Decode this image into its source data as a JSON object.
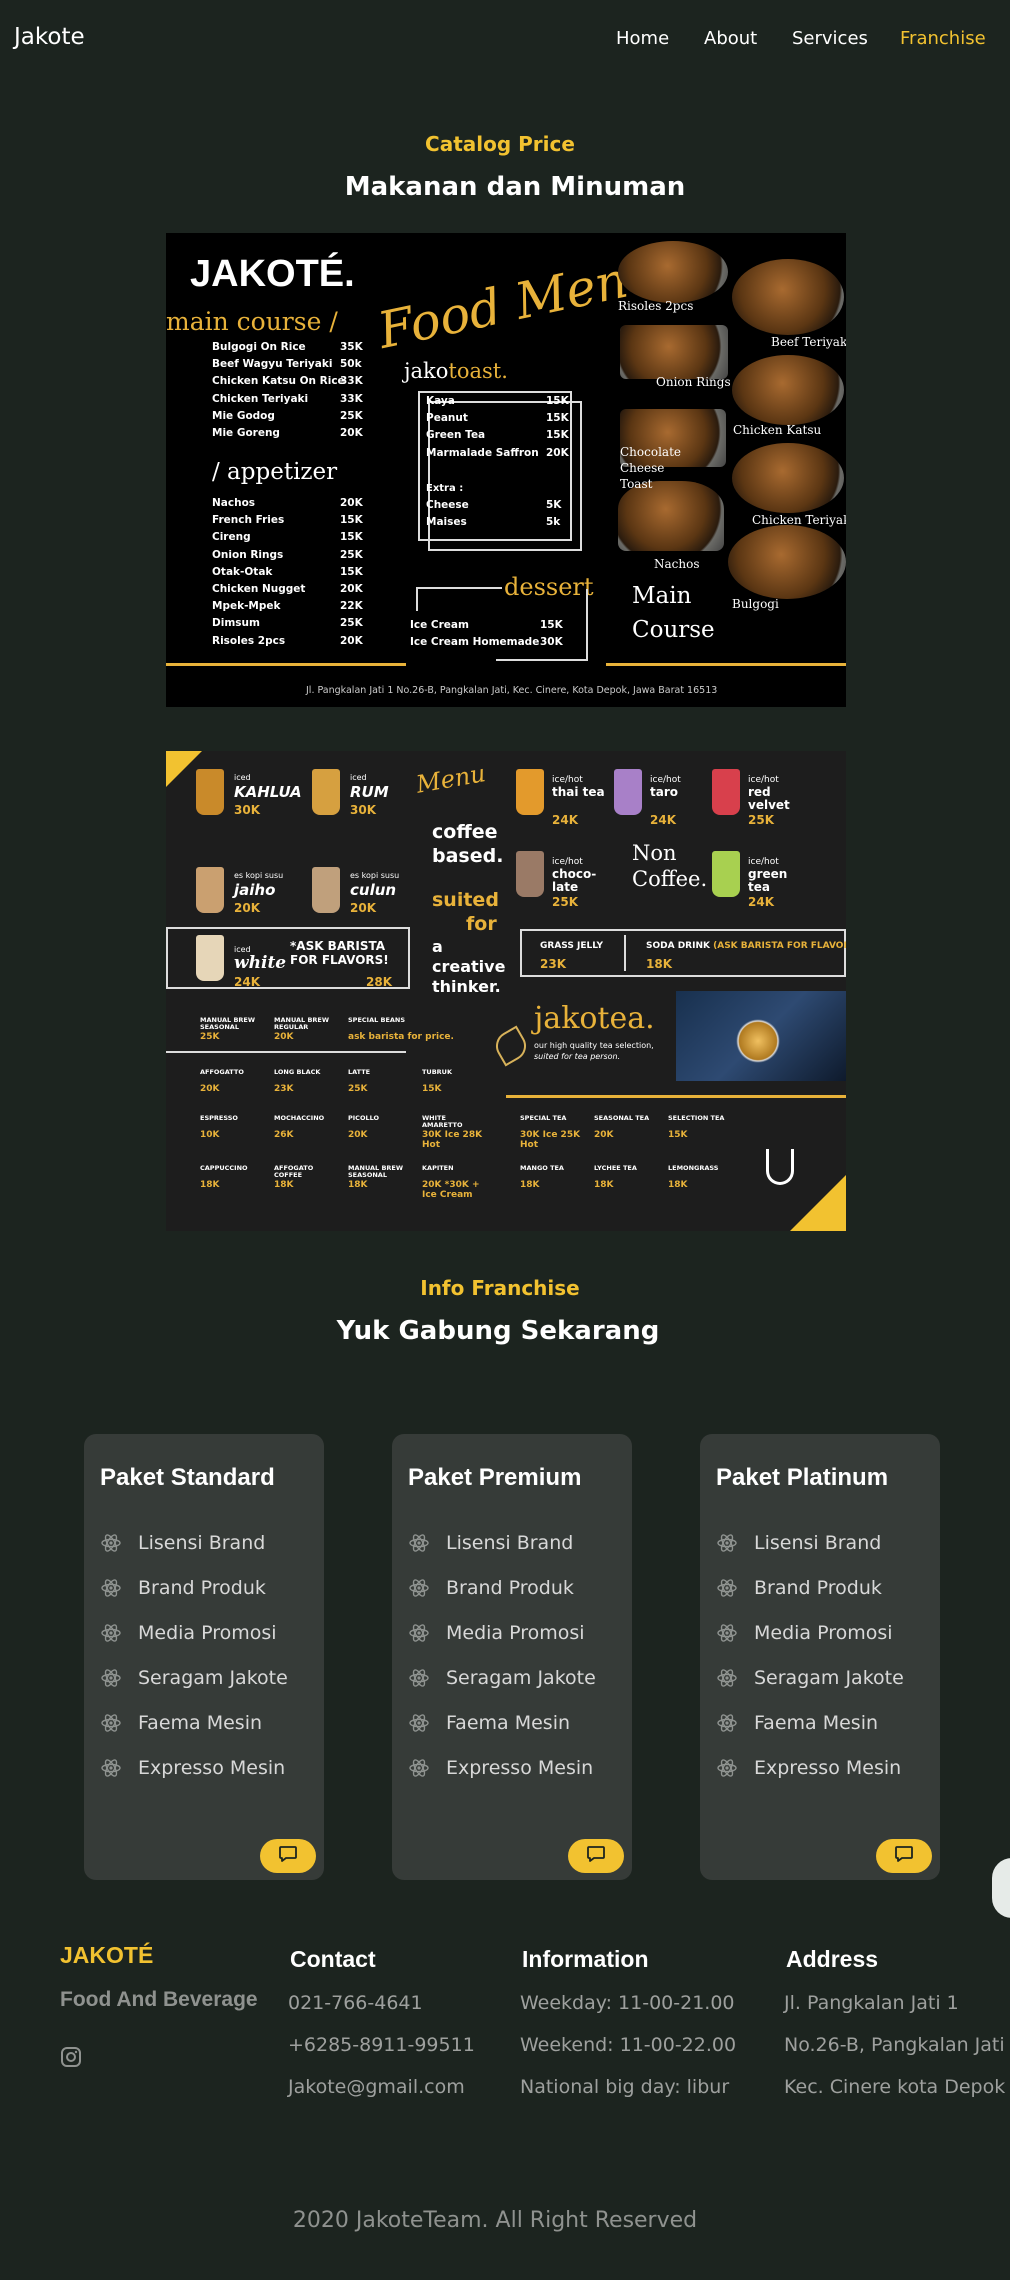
{
  "nav": {
    "brand": "Jakote",
    "links": [
      {
        "label": "Home"
      },
      {
        "label": "About"
      },
      {
        "label": "Services"
      },
      {
        "label": "Franchise",
        "active": true
      }
    ]
  },
  "catalog": {
    "subtitle": "Catalog Price",
    "title": "Makanan dan Minuman"
  },
  "food_menu": {
    "logo": "JAKOTÉ.",
    "script_title": "Food Menu",
    "main_course_heading": "main course /",
    "main_course": [
      {
        "name": "Bulgogi On Rice",
        "price": "35K"
      },
      {
        "name": "Beef Wagyu Teriyaki",
        "price": "50k"
      },
      {
        "name": "Chicken Katsu On Rice",
        "price": "33K"
      },
      {
        "name": "Chicken Teriyaki",
        "price": "33K"
      },
      {
        "name": "Mie Godog",
        "price": "25K"
      },
      {
        "name": "Mie Goreng",
        "price": "20K"
      }
    ],
    "appetizer_heading": "/ appetizer",
    "appetizer": [
      {
        "name": "Nachos",
        "price": "20K"
      },
      {
        "name": "French Fries",
        "price": "15K"
      },
      {
        "name": "Cireng",
        "price": "15K"
      },
      {
        "name": "Onion Rings",
        "price": "25K"
      },
      {
        "name": "Otak-Otak",
        "price": "15K"
      },
      {
        "name": "Chicken Nugget",
        "price": "20K"
      },
      {
        "name": "Mpek-Mpek",
        "price": "22K"
      },
      {
        "name": "Dimsum",
        "price": "25K"
      },
      {
        "name": "Risoles 2pcs",
        "price": "20K"
      }
    ],
    "toast_heading_a": "jako",
    "toast_heading_b": "toast.",
    "toast": [
      {
        "name": "Kaya",
        "price": "15K"
      },
      {
        "name": "Peanut",
        "price": "15K"
      },
      {
        "name": "Green Tea",
        "price": "15K"
      },
      {
        "name": "Marmalade Saffron",
        "price": "20K"
      }
    ],
    "extra_label": "Extra :",
    "extra": [
      {
        "name": "Cheese",
        "price": "5K"
      },
      {
        "name": "Maises",
        "price": "5k"
      }
    ],
    "dessert_heading": "dessert",
    "dessert": [
      {
        "name": "Ice Cream",
        "price": "15K"
      },
      {
        "name": "Ice Cream Homemade",
        "price": "30K"
      }
    ],
    "photo_labels": [
      "Risoles 2pcs",
      "Beef Teriyaki",
      "Onion Rings",
      "Chicken Katsu",
      "Chocolate",
      "Cheese",
      "Toast",
      "Chicken Teriyaki",
      "Nachos",
      "Bulgogi"
    ],
    "main_course_caption_1": "Main",
    "main_course_caption_2": "Course",
    "address": "Jl. Pangkalan Jati 1 No.26-B, Pangkalan Jati, Kec. Cinere, Kota Depok, Jawa Barat 16513"
  },
  "drink_menu": {
    "script_title": "Menu",
    "iced": [
      {
        "tag": "iced",
        "name": "KAHLUA",
        "price": "30K"
      },
      {
        "tag": "iced",
        "name": "RUM",
        "price": "30K"
      },
      {
        "tag": "es kopi susu",
        "name": "jaiho",
        "price": "20K"
      },
      {
        "tag": "es kopi susu",
        "name": "culun",
        "price": "20K"
      }
    ],
    "white": {
      "tag": "iced",
      "name": "white",
      "price": "24K"
    },
    "ask_barista": "*ASK BARISTA FOR FLAVORS!",
    "ask_price": "28K",
    "coffee_based_1": "coffee",
    "coffee_based_2": "based.",
    "suited_1": "suited",
    "suited_2": "for",
    "thinker_1": "a",
    "thinker_2": "creative",
    "thinker_3": "thinker.",
    "noncoffee_1": "Non",
    "noncoffee_2": "Coffee.",
    "tea_items": [
      {
        "tag": "ice/hot",
        "name": "thai tea",
        "price": "24K"
      },
      {
        "tag": "ice/hot",
        "name": "taro",
        "price": "24K"
      },
      {
        "tag": "ice/hot",
        "name": "red velvet",
        "price": "25K"
      },
      {
        "tag": "ice/hot",
        "name": "choco-late",
        "price": "25K"
      },
      {
        "tag": "ice/hot",
        "name": "green tea",
        "price": "24K"
      }
    ],
    "grass_jelly": "GRASS JELLY",
    "grass_jelly_price": "23K",
    "soda_drink": "SODA DRINK",
    "soda_note": "(ASK BARISTA FOR FLAVORS)",
    "soda_price": "18K",
    "jakotea": "jakotea.",
    "jakotea_tagline_1": "our high quality tea selection,",
    "jakotea_tagline_2": "suited for tea person.",
    "grid": [
      {
        "name": "MANUAL BREW SEASONAL",
        "price": "25K"
      },
      {
        "name": "MANUAL BREW REGULAR",
        "price": "20K"
      },
      {
        "name": "SPECIAL BEANS",
        "price": "ask barista for price."
      },
      {
        "name": "AFFOGATTO",
        "price": "20K"
      },
      {
        "name": "LONG BLACK",
        "price": "23K"
      },
      {
        "name": "LATTE",
        "price": "25K"
      },
      {
        "name": "TUBRUK",
        "price": "15K"
      },
      {
        "name": "ESPRESSO",
        "price": "10K"
      },
      {
        "name": "MOCHACCINO",
        "price": "26K"
      },
      {
        "name": "PICOLLO",
        "price": "20K"
      },
      {
        "name": "WHITE AMARETTO",
        "price": "30K Ice 28K Hot"
      },
      {
        "name": "SPECIAL TEA",
        "price": "30K Ice 25K Hot"
      },
      {
        "name": "SEASONAL TEA",
        "price": "20K"
      },
      {
        "name": "SELECTION TEA",
        "price": "15K"
      },
      {
        "name": "CAPPUCCINO",
        "price": "18K"
      },
      {
        "name": "AFFOGATO COFFEE",
        "price": "18K"
      },
      {
        "name": "MANUAL BREW SEASONAL",
        "price": "18K"
      },
      {
        "name": "KAPITEN",
        "price": "20K *30K + Ice Cream"
      },
      {
        "name": "MANGO TEA",
        "price": "18K"
      },
      {
        "name": "LYCHEE TEA",
        "price": "18K"
      },
      {
        "name": "LEMONGRASS",
        "price": "18K"
      }
    ]
  },
  "franchise": {
    "subtitle": "Info Franchise",
    "title": "Yuk Gabung Sekarang",
    "packages": [
      {
        "name": "Paket Standard",
        "features": [
          "Lisensi Brand",
          "Brand Produk",
          "Media Promosi",
          "Seragam Jakote",
          "Faema Mesin",
          "Expresso Mesin"
        ]
      },
      {
        "name": "Paket Premium",
        "features": [
          "Lisensi Brand",
          "Brand Produk",
          "Media Promosi",
          "Seragam Jakote",
          "Faema Mesin",
          "Expresso Mesin"
        ]
      },
      {
        "name": "Paket Platinum",
        "features": [
          "Lisensi Brand",
          "Brand Produk",
          "Media Promosi",
          "Seragam Jakote",
          "Faema Mesin",
          "Expresso Mesin"
        ]
      }
    ]
  },
  "footer": {
    "brand": "JAKOTÉ",
    "tagline": "Food And Beverage",
    "contact": {
      "heading": "Contact",
      "lines": [
        "021-766-4641",
        "+6285-8911-99511",
        "Jakote@gmail.com"
      ]
    },
    "information": {
      "heading": "Information",
      "lines": [
        "Weekday: 11-00-21.00",
        "Weekend: 11-00-22.00",
        "National big day: libur"
      ]
    },
    "address": {
      "heading": "Address",
      "lines": [
        "Jl. Pangkalan Jati 1",
        "No.26-B, Pangkalan Jati",
        "Kec. Cinere kota Depok"
      ]
    },
    "copyright": "2020 JakoteTeam. All Right Reserved"
  },
  "colors": {
    "background": "#1c241f",
    "accent": "#f2c230",
    "card": "#363b38"
  },
  "icons": [
    "instagram-icon",
    "chat-icon",
    "atom-icon"
  ]
}
